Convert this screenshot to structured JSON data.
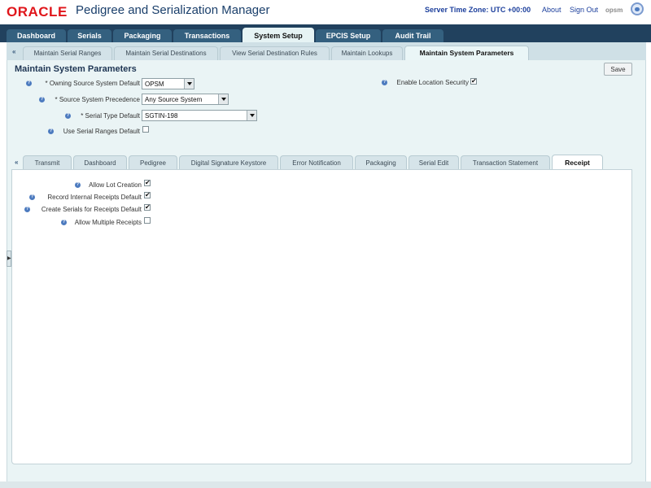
{
  "header": {
    "logo": "ORACLE",
    "app_title": "Pedigree and Serialization Manager",
    "server_time_zone": "Server Time Zone: UTC +00:00",
    "about_link": "About",
    "sign_out_link": "Sign Out",
    "user_name": "opsm"
  },
  "main_tabs": [
    {
      "label": "Dashboard"
    },
    {
      "label": "Serials"
    },
    {
      "label": "Packaging"
    },
    {
      "label": "Transactions"
    },
    {
      "label": "System Setup"
    },
    {
      "label": "EPCIS Setup"
    },
    {
      "label": "Audit Trail"
    }
  ],
  "main_tabs_active": "System Setup",
  "sub_tabs": {
    "back": "«",
    "items": [
      {
        "label": "Maintain Serial Ranges"
      },
      {
        "label": "Maintain Serial Destinations"
      },
      {
        "label": "View Serial Destination Rules"
      },
      {
        "label": "Maintain Lookups"
      },
      {
        "label": "Maintain System Parameters"
      }
    ]
  },
  "page": {
    "title": "Maintain System Parameters",
    "save_label": "Save",
    "help_glyph": "?",
    "fields": {
      "owning_source": {
        "label": "* Owning Source System Default",
        "value": "OPSM"
      },
      "source_precedence": {
        "label": "* Source System Precedence",
        "value": "Any Source System"
      },
      "serial_type": {
        "label": "* Serial Type Default",
        "value": "SGTIN-198"
      },
      "use_serial_ranges": {
        "label": "Use Serial Ranges Default",
        "checked": false
      },
      "enable_location_security": {
        "label": "Enable Location Security",
        "checked": true
      }
    }
  },
  "inner_tabs": {
    "back": "«",
    "items": [
      {
        "label": "Transmit"
      },
      {
        "label": "Dashboard"
      },
      {
        "label": "Pedigree"
      },
      {
        "label": "Digital Signature Keystore"
      },
      {
        "label": "Error Notification"
      },
      {
        "label": "Packaging"
      },
      {
        "label": "Serial Edit"
      },
      {
        "label": "Transaction Statement"
      },
      {
        "label": "Receipt"
      }
    ],
    "active": "Receipt"
  },
  "receipt": {
    "allow_lot_creation": {
      "label": "Allow Lot Creation",
      "checked": true
    },
    "record_internal_receipts": {
      "label": "Record Internal Receipts Default",
      "checked": true
    },
    "create_serials_for_receipts": {
      "label": "Create Serials for Receipts Default",
      "checked": true
    },
    "allow_multiple_receipts": {
      "label": "Allow Multiple Receipts",
      "checked": false
    }
  },
  "check_glyph": "✔",
  "colors": {
    "brand_red": "#e0161b",
    "nav_dark": "#21415e",
    "link_blue": "#1c3f9c",
    "panel_bg": "#eaf4f5"
  }
}
